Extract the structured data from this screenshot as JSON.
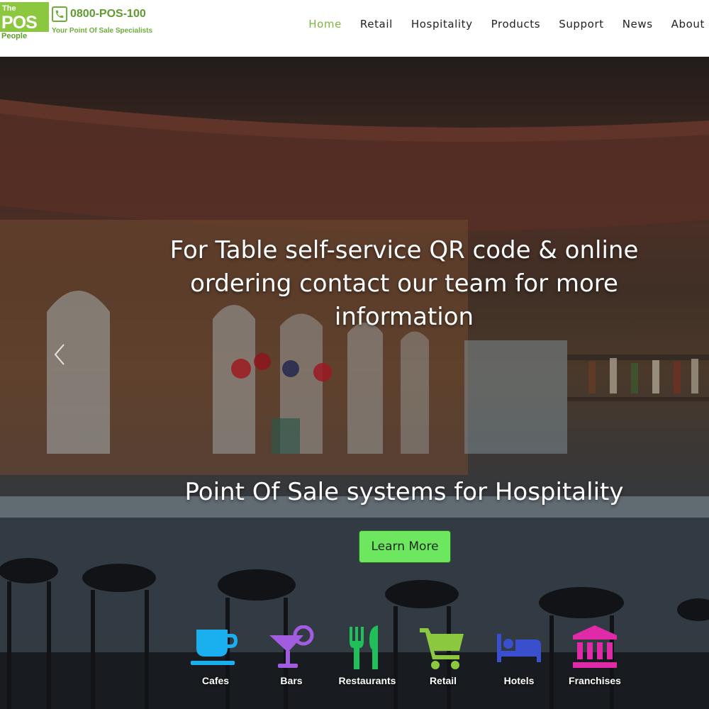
{
  "brand": {
    "logo_the": "The",
    "logo_pos": "POS",
    "logo_people": "People",
    "phone": "0800-POS-100",
    "tagline": "Your Point Of Sale Specialists",
    "brand_green": "#8cc83f"
  },
  "nav": {
    "items": [
      {
        "label": "Home",
        "active": true
      },
      {
        "label": "Retail",
        "active": false
      },
      {
        "label": "Hospitality",
        "active": false
      },
      {
        "label": "Products",
        "active": false
      },
      {
        "label": "Support",
        "active": false
      },
      {
        "label": "News",
        "active": false
      },
      {
        "label": "About",
        "active": false
      }
    ],
    "active_color": "#7fb544"
  },
  "hero": {
    "headline": "For Table self-service QR code & online ordering contact our team for more information",
    "subheadline": "Point Of Sale systems for Hospitality",
    "cta_label": "Learn More",
    "cta_color": "#6ee760",
    "prev_icon": "chevron-left-icon"
  },
  "categories": [
    {
      "label": "Cafes",
      "icon": "coffee-cup-icon",
      "color": "#1ab0f0"
    },
    {
      "label": "Bars",
      "icon": "cocktail-glass-icon",
      "color": "#a25ce0"
    },
    {
      "label": "Restaurants",
      "icon": "fork-knife-icon",
      "color": "#1fc05a"
    },
    {
      "label": "Retail",
      "icon": "shopping-cart-icon",
      "color": "#8cc83f"
    },
    {
      "label": "Hotels",
      "icon": "bed-icon",
      "color": "#3a4fd0"
    },
    {
      "label": "Franchises",
      "icon": "bank-building-icon",
      "color": "#e02aa8"
    }
  ]
}
